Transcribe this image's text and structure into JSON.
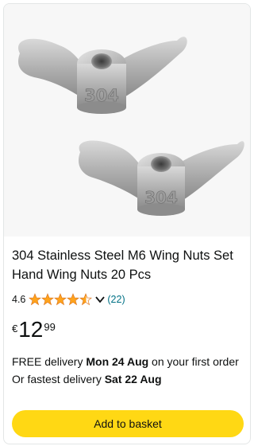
{
  "product": {
    "title": "304 Stainless Steel M6 Wing Nuts Set Hand Wing Nuts 20 Pcs",
    "image_label": "304",
    "rating": {
      "value": "4.6",
      "stars_fraction": 0.92,
      "count": "(22)"
    },
    "price": {
      "currency": "€",
      "whole": "12",
      "fraction": "99"
    },
    "delivery": {
      "line1_prefix": "FREE delivery ",
      "line1_date": "Mon 24 Aug",
      "line1_suffix": " on your first order",
      "line2_prefix": "Or fastest delivery ",
      "line2_date": "Sat 22 Aug"
    },
    "add_button_label": "Add to basket"
  },
  "colors": {
    "star": "#FFA41C",
    "link": "#007185",
    "button": "#FFD814"
  },
  "icons": [
    "star-icon",
    "chevron-down-icon"
  ]
}
